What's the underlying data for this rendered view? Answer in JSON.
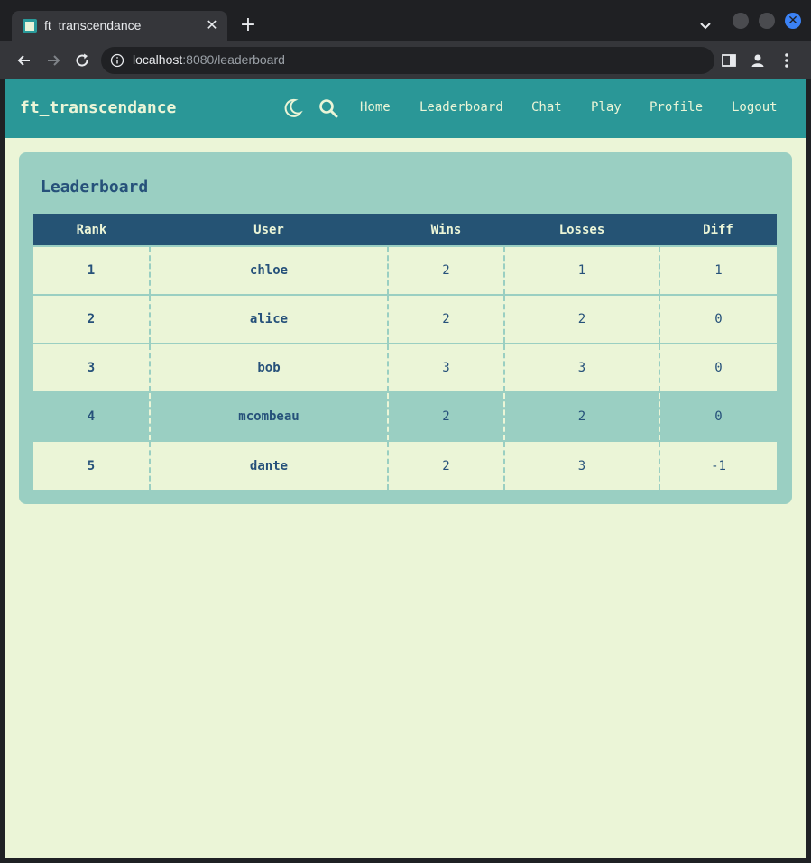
{
  "browser": {
    "tab_title": "ft_transcendance",
    "url_host": "localhost",
    "url_path": ":8080/leaderboard"
  },
  "navbar": {
    "brand": "ft_transcendance",
    "links": [
      "Home",
      "Leaderboard",
      "Chat",
      "Play",
      "Profile",
      "Logout"
    ]
  },
  "leaderboard": {
    "title": "Leaderboard",
    "columns": [
      "Rank",
      "User",
      "Wins",
      "Losses",
      "Diff"
    ],
    "rows": [
      {
        "rank": "1",
        "user": "chloe",
        "wins": "2",
        "losses": "1",
        "diff": "1"
      },
      {
        "rank": "2",
        "user": "alice",
        "wins": "2",
        "losses": "2",
        "diff": "0"
      },
      {
        "rank": "3",
        "user": "bob",
        "wins": "3",
        "losses": "3",
        "diff": "0"
      },
      {
        "rank": "4",
        "user": "mcombeau",
        "wins": "2",
        "losses": "2",
        "diff": "0"
      },
      {
        "rank": "5",
        "user": "dante",
        "wins": "2",
        "losses": "3",
        "diff": "-1"
      }
    ]
  },
  "colors": {
    "navbar": "#2a9797",
    "page_bg": "#ebf5d7",
    "card_bg": "#9acfc2",
    "table_header": "#255374",
    "text": "#26517a"
  }
}
